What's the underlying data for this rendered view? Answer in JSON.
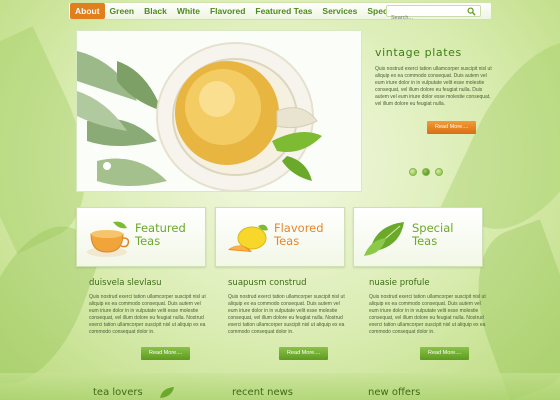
{
  "nav": {
    "items": [
      "About",
      "Green",
      "Black",
      "White",
      "Flavored",
      "Featured Teas",
      "Services",
      "Specials"
    ],
    "active": "About",
    "search_placeholder": "Search..."
  },
  "slider": {
    "title": "vintage plates",
    "text": "Quis nostrud exerci tation ullamcorper suscipit nisl ut aliquip ex ea commodo consequat. Duis autem vel eum iriure dolor in in vulputate velit esse molestie consequat, vel illum dolore eu feugiat nulla. Duis autem vel eum iriure dolor esse molestie consequat, vel illum dolore eu feugiat nulla.",
    "button": "Read More....",
    "slide_count": 3,
    "active_slide": 2
  },
  "boxes": [
    {
      "line1": "Featured",
      "line2": "Teas",
      "icon": "tea-cup-icon"
    },
    {
      "line1": "Flavored",
      "line2": "Teas",
      "icon": "lemon-icon"
    },
    {
      "line1": "Special",
      "line2": "Teas",
      "icon": "leaf-icon"
    }
  ],
  "columns": [
    {
      "title": "duisvela slevlasu",
      "text": "Quis nostrud exerci tation ullamcorper suscipit nisl ut aliquip ex ea commodo consequat. Duis autem vel eum iriure dolor in in vulputate velit esse molestie consequat, vel illum dolore eu feugiat nulla. Nostrud exerci tation ullamcorper suscipit nisl ut aliquip ex ea commodo consequat dolor in.",
      "button": "Read More...."
    },
    {
      "title": "suapusm construd",
      "text": "Quis nostrud exerci tation ullamcorper suscipit nisl ut aliquip ex ea commodo consequat. Duis autem vel eum iriure dolor in in vulputate velit esse molestie consequat, vel illum dolore eu feugiat nulla. Nostrud exerci tation ullamcorper suscipit nisl ut aliquip ex ea commodo consequat dolor in.",
      "button": "Read More...."
    },
    {
      "title": "nuasie profule",
      "text": "Quis nostrud exerci tation ullamcorper suscipit nisl ut aliquip ex ea commodo consequat. Duis autem vel eum iriure dolor in in vulputate velit esse molestie consequat, vel illum dolore eu feugiat nulla. Nostrud exerci tation ullamcorper suscipit nisl ut aliquip ex ea commodo consequat dolor in.",
      "button": "Read More...."
    }
  ],
  "footer": {
    "items": [
      "tea lovers",
      "recent news",
      "new offers"
    ]
  },
  "colors": {
    "accent_orange": "#e07f1c",
    "accent_green": "#4e8a1e",
    "light_green": "#d9ecb0"
  }
}
